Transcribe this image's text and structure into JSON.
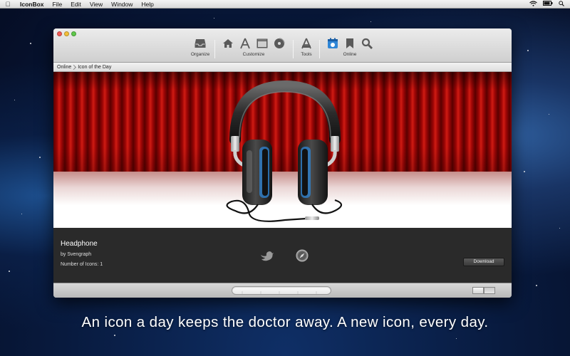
{
  "menubar": {
    "app_name": "IconBox",
    "items": [
      "File",
      "Edit",
      "View",
      "Window",
      "Help"
    ]
  },
  "toolbar": {
    "groups": [
      {
        "label": "Organize",
        "icons": [
          "tray-icon"
        ]
      },
      {
        "label": "Customize",
        "icons": [
          "home-icon",
          "app-store-icon",
          "window-icon",
          "disc-icon"
        ]
      },
      {
        "label": "Tools",
        "icons": [
          "tools-a-icon"
        ]
      },
      {
        "label": "Online",
        "icons": [
          "icon-of-day-icon",
          "bookmark-icon",
          "search-icon"
        ]
      }
    ]
  },
  "breadcrumb": {
    "items": [
      "Online",
      "Icon of the Day"
    ]
  },
  "icon_info": {
    "title": "Headphone",
    "author": "by Svengraph",
    "count": "Number of Icons: 1",
    "download_label": "Download"
  },
  "tagline": "An icon a day keeps the doctor away. A new icon, every day.",
  "colors": {
    "curtain": "#b00c08",
    "panel": "#2a2a2a",
    "accent_blue": "#2f86d6"
  }
}
